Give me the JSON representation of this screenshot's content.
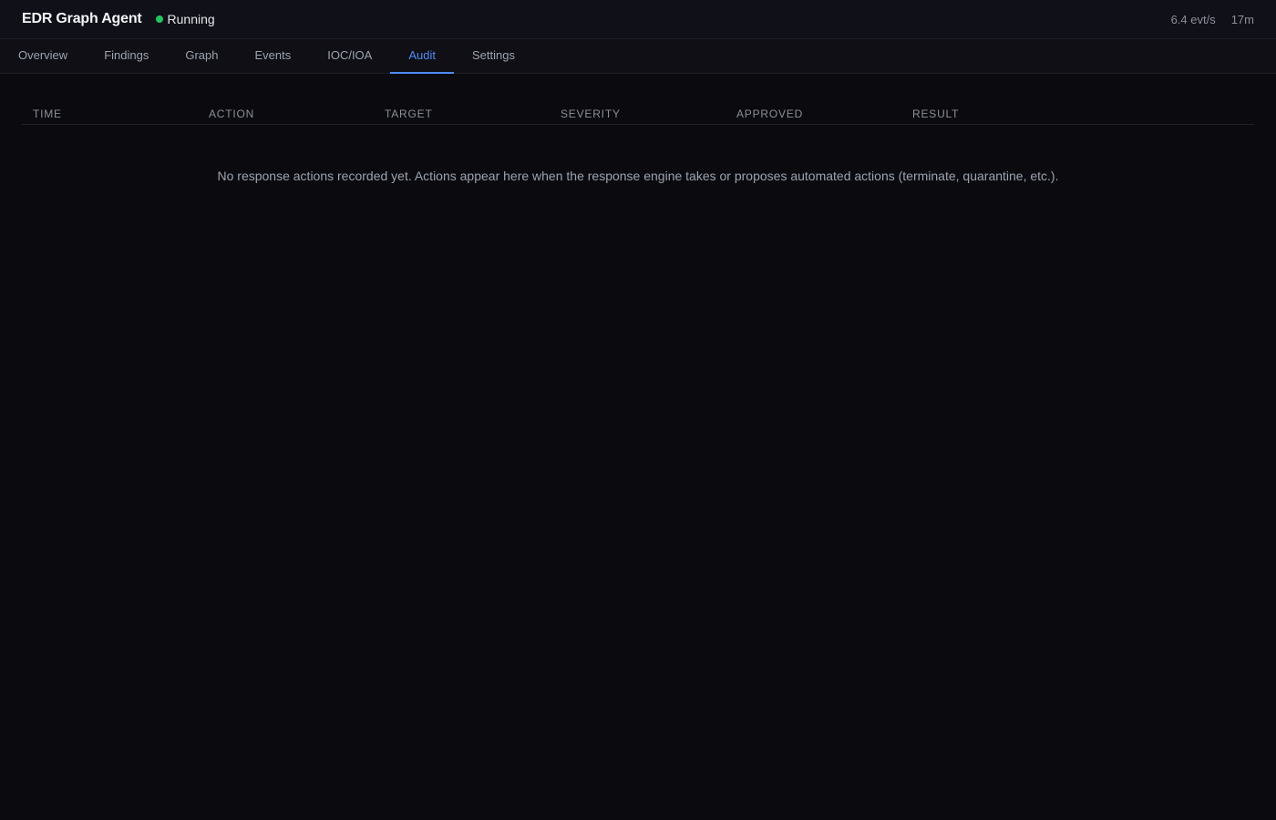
{
  "header": {
    "title": "EDR Graph Agent",
    "status": {
      "label": "Running",
      "color": "#22c55e",
      "icon": "status-dot-icon"
    },
    "event_rate": "6.4 evt/s",
    "uptime": "17m"
  },
  "tabs": [
    {
      "label": "Overview",
      "active": false
    },
    {
      "label": "Findings",
      "active": false
    },
    {
      "label": "Graph",
      "active": false
    },
    {
      "label": "Events",
      "active": false
    },
    {
      "label": "IOC/IOA",
      "active": false
    },
    {
      "label": "Audit",
      "active": true
    },
    {
      "label": "Settings",
      "active": false
    }
  ],
  "audit": {
    "columns": [
      "TIME",
      "ACTION",
      "TARGET",
      "SEVERITY",
      "APPROVED",
      "RESULT"
    ],
    "rows": [],
    "empty_message": "No response actions recorded yet. Actions appear here when the response engine takes or proposes automated actions (terminate, quarantine, etc.)."
  },
  "colors": {
    "accent": "#4f8bf5",
    "background": "#0b0b0f",
    "status_running": "#22c55e"
  }
}
